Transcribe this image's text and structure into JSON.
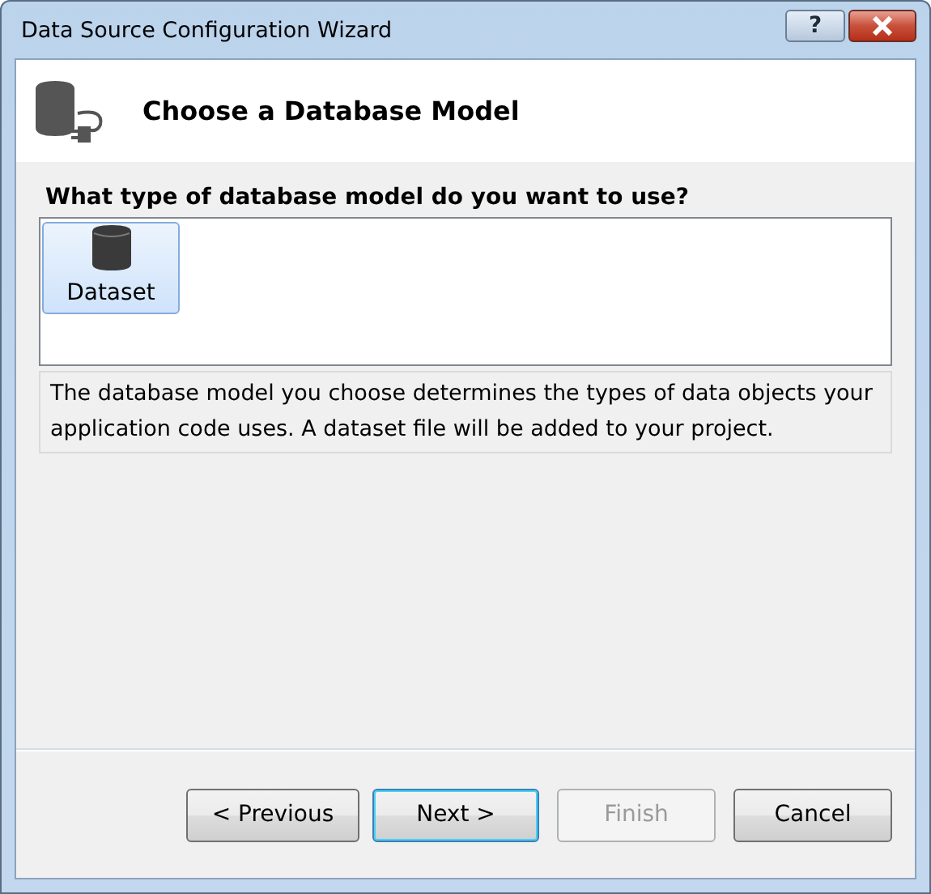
{
  "window": {
    "title": "Data Source Configuration Wizard",
    "help_button": "?"
  },
  "header": {
    "title": "Choose a Database Model"
  },
  "question": "What type of database model do you want to use?",
  "models": [
    {
      "label": "Dataset",
      "selected": true
    }
  ],
  "description": "The database model you choose determines the types of data objects your application code uses. A dataset file will be added to your project.",
  "buttons": [
    {
      "label": "< Previous",
      "disabled": false,
      "default": false
    },
    {
      "label": "Next >",
      "disabled": false,
      "default": true
    },
    {
      "label": "Finish",
      "disabled": true,
      "default": false
    },
    {
      "label": "Cancel",
      "disabled": false,
      "default": false
    }
  ]
}
